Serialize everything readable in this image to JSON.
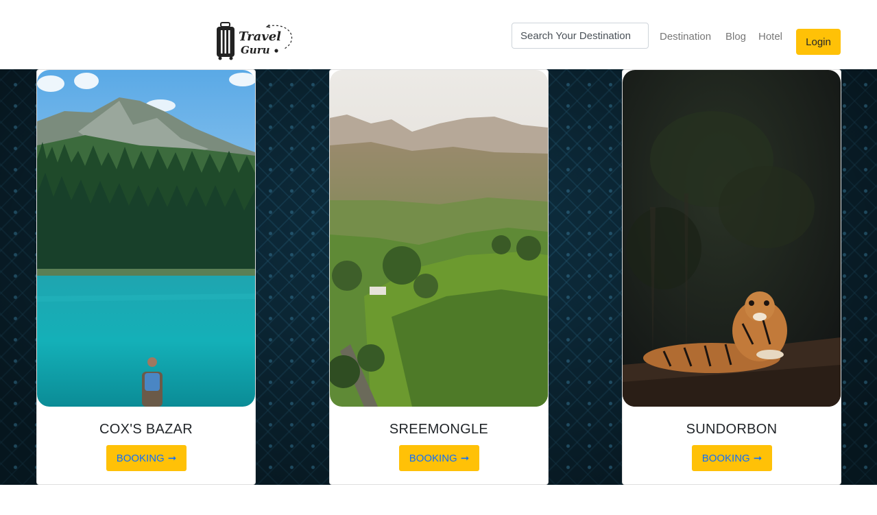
{
  "brand": {
    "line1": "Travel",
    "line2": "Guru"
  },
  "header": {
    "search_placeholder": "Search Your Destination",
    "nav": [
      {
        "label": "Destination"
      },
      {
        "label": "Blog"
      },
      {
        "label": "Hotel"
      }
    ],
    "login_label": "Login"
  },
  "cards": [
    {
      "title": "COX'S BAZAR",
      "button": "BOOKING",
      "arrow": "➞",
      "image": "mountain-lake-hiker"
    },
    {
      "title": "SREEMONGLE",
      "button": "BOOKING",
      "arrow": "➞",
      "image": "tea-garden-hills"
    },
    {
      "title": "SUNDORBON",
      "button": "BOOKING",
      "arrow": "➞",
      "image": "tiger-forest"
    }
  ],
  "colors": {
    "accent": "#ffc107",
    "link": "#0d6efd",
    "background": "#0e3042"
  }
}
